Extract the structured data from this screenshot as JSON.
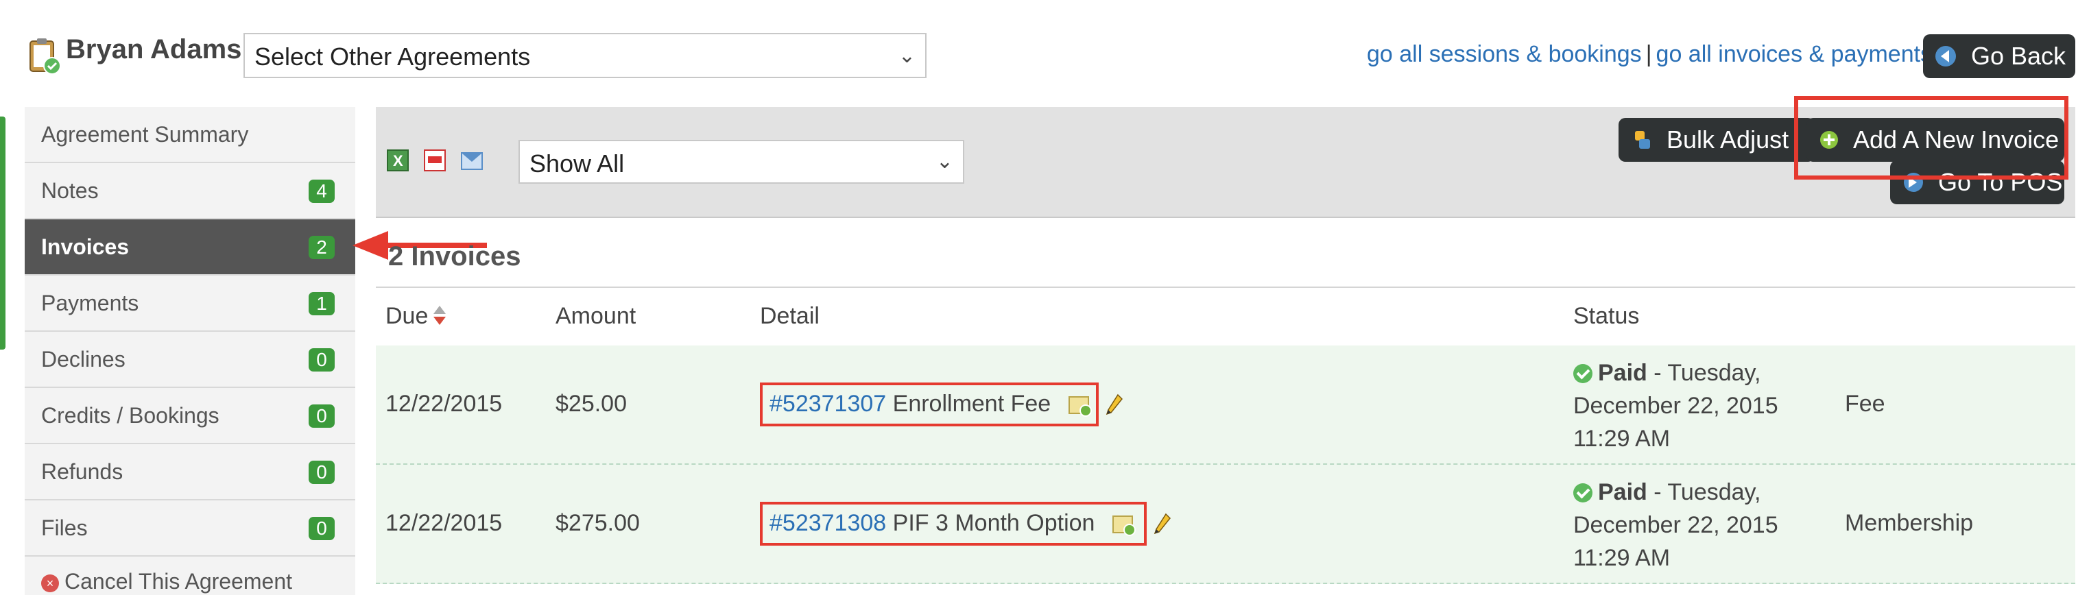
{
  "header": {
    "client_name": "Bryan Adams",
    "agreement_select": "Select Other Agreements",
    "links": {
      "sessions": "go all sessions & bookings",
      "separator": "|",
      "invoices": "go all invoices & payments"
    },
    "go_back": "Go Back"
  },
  "sidebar": {
    "items": [
      {
        "label": "Agreement Summary",
        "badge": null
      },
      {
        "label": "Notes",
        "badge": "4"
      },
      {
        "label": "Invoices",
        "badge": "2",
        "active": true
      },
      {
        "label": "Payments",
        "badge": "1"
      },
      {
        "label": "Declines",
        "badge": "0"
      },
      {
        "label": "Credits / Bookings",
        "badge": "0"
      },
      {
        "label": "Refunds",
        "badge": "0"
      },
      {
        "label": "Files",
        "badge": "0"
      }
    ],
    "cancel": "Cancel This Agreement"
  },
  "toolbar": {
    "filter": "Show All",
    "bulk_adjust": "Bulk Adjust",
    "add_invoice": "Add A New Invoice",
    "go_to_pos": "Go To POS"
  },
  "invoices": {
    "count_title": "2 Invoices",
    "columns": {
      "due": "Due",
      "amount": "Amount",
      "detail": "Detail",
      "status": "Status"
    },
    "rows": [
      {
        "due": "12/22/2015",
        "amount": "$25.00",
        "invoice_number": "#52371307",
        "description": "Enrollment Fee",
        "status_label": "Paid",
        "status_line1": " - Tuesday,",
        "status_line2": "December 22, 2015",
        "status_line3": "11:29 AM",
        "type": "Fee"
      },
      {
        "due": "12/22/2015",
        "amount": "$275.00",
        "invoice_number": "#52371308",
        "description": "PIF 3 Month Option",
        "status_label": "Paid",
        "status_line1": " - Tuesday,",
        "status_line2": "December 22, 2015",
        "status_line3": "11:29 AM",
        "type": "Membership"
      }
    ]
  },
  "colors": {
    "accent_blue": "#2a6fb5",
    "dark_button": "#2f3334",
    "badge_green": "#3b9a3b",
    "highlight_red": "#e53a2f",
    "row_green": "#eef7ee"
  }
}
